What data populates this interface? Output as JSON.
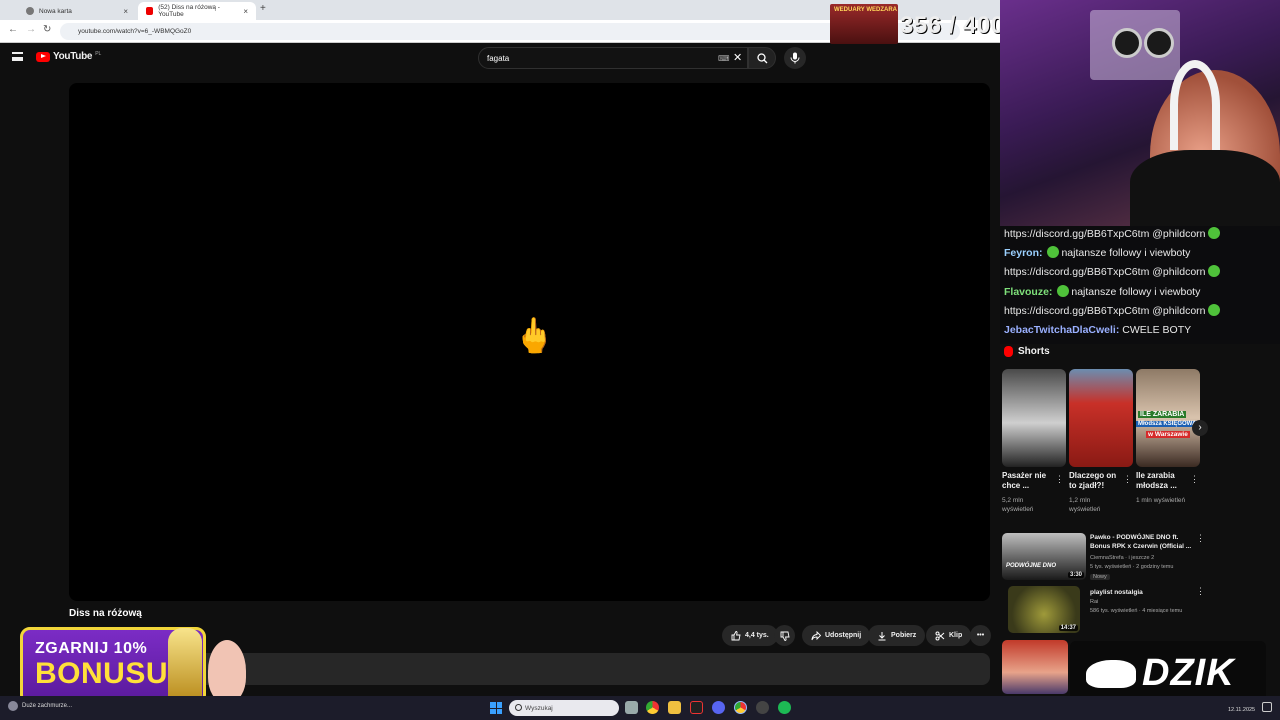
{
  "browser": {
    "tabs": [
      {
        "title": "Nowa karta",
        "active": false
      },
      {
        "title": "(52) Diss na różową - YouTube",
        "active": true
      }
    ],
    "url": "youtube.com/watch?v=6_-WBMQGoZ0"
  },
  "youtube": {
    "logo_text": "YouTube",
    "logo_country": "PL",
    "search_value": "fagata"
  },
  "video": {
    "title": "Diss na różową",
    "center_emoji": "🖕",
    "actions": {
      "likes": "4,4 tys.",
      "share": "Udostępnij",
      "download": "Pobierz",
      "clip": "Klip"
    }
  },
  "stream_overlay": {
    "counter": "356 / 400",
    "banner_text": "WEDUARY WEDZARA",
    "promo_line1": "ZGARNIJ 10%",
    "promo_line2": "BONUSU",
    "brand": "DZIK"
  },
  "chat": [
    {
      "user": "",
      "text": "https://discord.gg/BB6TxpC6tm @phildcorn",
      "emote_after": true
    },
    {
      "user": "Feyron:",
      "user_color": "#9bd0ff",
      "emote_before": true,
      "text": "najtansze followy i viewboty"
    },
    {
      "user": "",
      "text": "https://discord.gg/BB6TxpC6tm @phildcorn",
      "emote_after": true
    },
    {
      "user": "Flavouze:",
      "user_color": "#7ee07a",
      "emote_before": true,
      "text": "najtansze followy i viewboty"
    },
    {
      "user": "",
      "text": "https://discord.gg/BB6TxpC6tm @phildcorn",
      "emote_after": true
    },
    {
      "user": "JebacTwitchaDlaCweli:",
      "user_color": "#9ab0ff",
      "emote_before": false,
      "text": "CWELE BOTY"
    }
  ],
  "shorts": {
    "heading": "Shorts",
    "items": [
      {
        "title": "Pasażer nie chce ...",
        "views": "5,2 mln wyświetleń"
      },
      {
        "title": "Dlaczego on to zjadł?!",
        "views": "1,2 mln wyświetleń"
      },
      {
        "title": "Ile zarabia młodsza ...",
        "views": "1 mln wyświetleń"
      }
    ],
    "thumb3_text1": "ILE ZARABIA",
    "thumb3_text2": "Młodsza KSIĘGOWA",
    "thumb3_text3": "w Warszawie"
  },
  "recommended": [
    {
      "title": "Pawko - PODWÓJNE DNO ft. Bonus RPK x Czerwin (Official ...",
      "channel": "CiemnaStrefa · i jeszcze 2",
      "meta": "5 tys. wyświetleń · 2 godziny temu",
      "badge": "Nowy",
      "duration": "3:30",
      "thumb_text": "PODWÓJNE DNO"
    },
    {
      "title": "playlist nostalgia",
      "channel": "Rai",
      "meta": "586 tys. wyświetleń · 4 miesiące temu",
      "badge": "",
      "duration": "14:37"
    }
  ],
  "taskbar": {
    "weather_text": "Duże zachmurze...",
    "search_placeholder": "Wyszukaj",
    "date": "12.11.2025"
  },
  "colors": {
    "yt_red": "#ff0000",
    "bg": "#0f0f0f",
    "promo_purple": "#7b2cc5",
    "promo_yellow": "#ffe03a",
    "emote_green": "#4fc23a"
  }
}
